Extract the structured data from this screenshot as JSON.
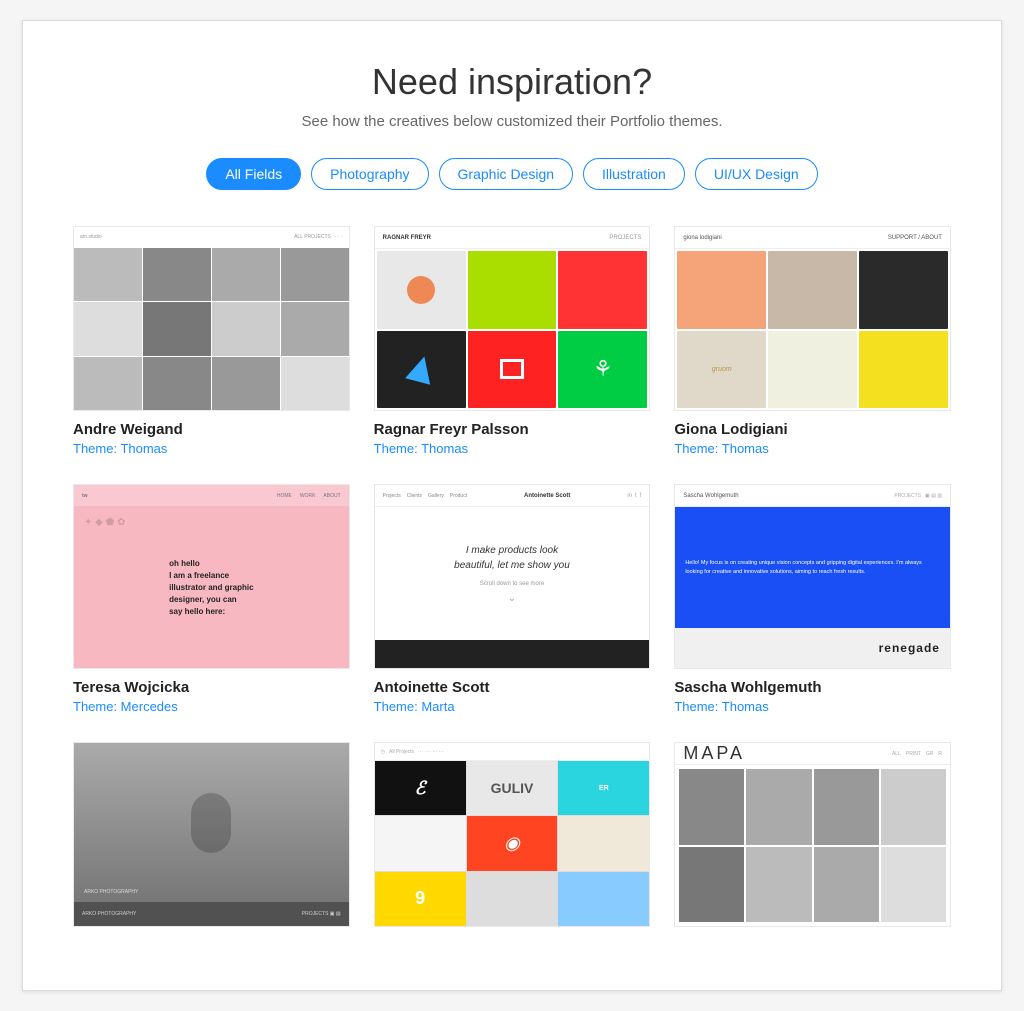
{
  "header": {
    "title": "Need inspiration?",
    "subtitle": "See how the creatives below customized their Portfolio themes."
  },
  "filters": [
    {
      "label": "All Fields",
      "active": true
    },
    {
      "label": "Photography",
      "active": false
    },
    {
      "label": "Graphic Design",
      "active": false
    },
    {
      "label": "Illustration",
      "active": false
    },
    {
      "label": "UI/UX Design",
      "active": false
    }
  ],
  "cards": [
    {
      "name": "Andre Weigand",
      "theme_label": "Theme: Thomas",
      "type": "andre"
    },
    {
      "name": "Ragnar Freyr Palsson",
      "theme_label": "Theme: Thomas",
      "type": "ragnar"
    },
    {
      "name": "Giona Lodigiani",
      "theme_label": "Theme: Thomas",
      "type": "giona"
    },
    {
      "name": "Teresa Wojcicka",
      "theme_label": "Theme: Mercedes",
      "type": "teresa"
    },
    {
      "name": "Antoinette Scott",
      "theme_label": "Theme: Marta",
      "type": "antoinette"
    },
    {
      "name": "Sascha Wohlgemuth",
      "theme_label": "Theme: Thomas",
      "type": "sascha"
    },
    {
      "name": "",
      "theme_label": "",
      "type": "row3a"
    },
    {
      "name": "",
      "theme_label": "",
      "type": "row3b"
    },
    {
      "name": "",
      "theme_label": "",
      "type": "row3c"
    }
  ],
  "ragnar": {
    "topbar_name": "RAGNAR FREYR",
    "topbar_label": "PROJECTS"
  },
  "giona": {
    "topbar_name": "giona lodigiani",
    "topbar_label": "SUPPORT / ABOUT"
  },
  "teresa": {
    "logo": "tw",
    "nav1": "HOME",
    "nav2": "WORK",
    "nav3": "ABOUT",
    "body_text": "oh hello\nI am a freelance\nillustrator and graphic\ndesigner, you can\nsay hello here:"
  },
  "antoinette": {
    "nav": [
      "Projects",
      "Clients",
      "Gallery",
      "Product"
    ],
    "name": "Antoinette Scott",
    "headline": "I make products look\nbeautiful, let me show you",
    "scroll_text": "Scroll down to see more"
  },
  "sascha": {
    "name": "Sascha Wohlgemuth",
    "label": "PROJECTS",
    "body_text": "Hello! My focus is on creating unique vision concepts and gripping digital experiences. I'm always looking for creative and innovative solutions, aiming to reach fresh results.",
    "renegade": "renegade"
  }
}
